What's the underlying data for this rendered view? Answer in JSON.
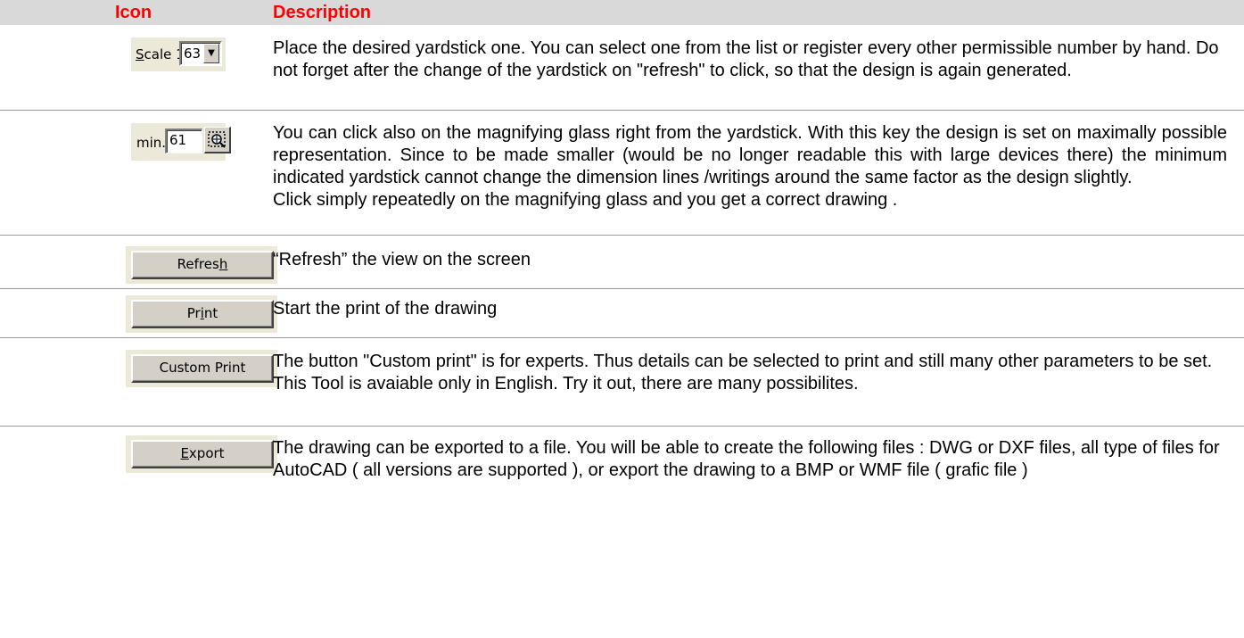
{
  "header": {
    "icon_col": "Icon",
    "description_col": "Description"
  },
  "rows": [
    {
      "icon": {
        "type": "scale-combo",
        "label_underline": "S",
        "label_rest": "cale 1:",
        "value": "63"
      },
      "description": [
        "Place the desired yardstick one. You can select one from the list or register every other permissible number by hand. Do not forget after the change of the yardstick on \"refresh\" to click, so that the design is again generated."
      ]
    },
    {
      "icon": {
        "type": "min-field",
        "label": "min.",
        "value": "61",
        "button_icon": "zoom-extents-icon"
      },
      "description": [
        "You can click also on the magnifying glass right from the yardstick. With this key the design is set on maximally possible representation. Since to be made smaller (would be no longer readable this with large devices there) the minimum indicated yardstick cannot change the dimension lines /writings around the same factor as the design slightly.",
        "Click simply repeatedly on the magnifying glass and you get a correct drawing ."
      ]
    },
    {
      "icon": {
        "type": "button",
        "label_before": "Refres",
        "label_underline": "h",
        "label_after": ""
      },
      "description": [
        "“Refresh” the view on the screen"
      ]
    },
    {
      "icon": {
        "type": "button",
        "label_before": "Pr",
        "label_underline": "i",
        "label_after": "nt"
      },
      "description": [
        "Start the print of the drawing"
      ]
    },
    {
      "icon": {
        "type": "button",
        "label_before": "Custom Print",
        "label_underline": "",
        "label_after": ""
      },
      "description": [
        "The button \"Custom print\" is for experts. Thus details can be selected to print and still many other parameters to be set. This Tool is avaiable only in English. Try it out, there are many possibilites."
      ]
    },
    {
      "icon": {
        "type": "button",
        "label_before": "",
        "label_underline": "E",
        "label_after": "xport"
      },
      "description": [
        "The drawing can be exported to a file. You will be able to create the following files : DWG or DXF files, all type of files for AutoCAD ( all versions  are supported ), or export the drawing to a BMP or WMF file ( grafic file )"
      ]
    }
  ]
}
